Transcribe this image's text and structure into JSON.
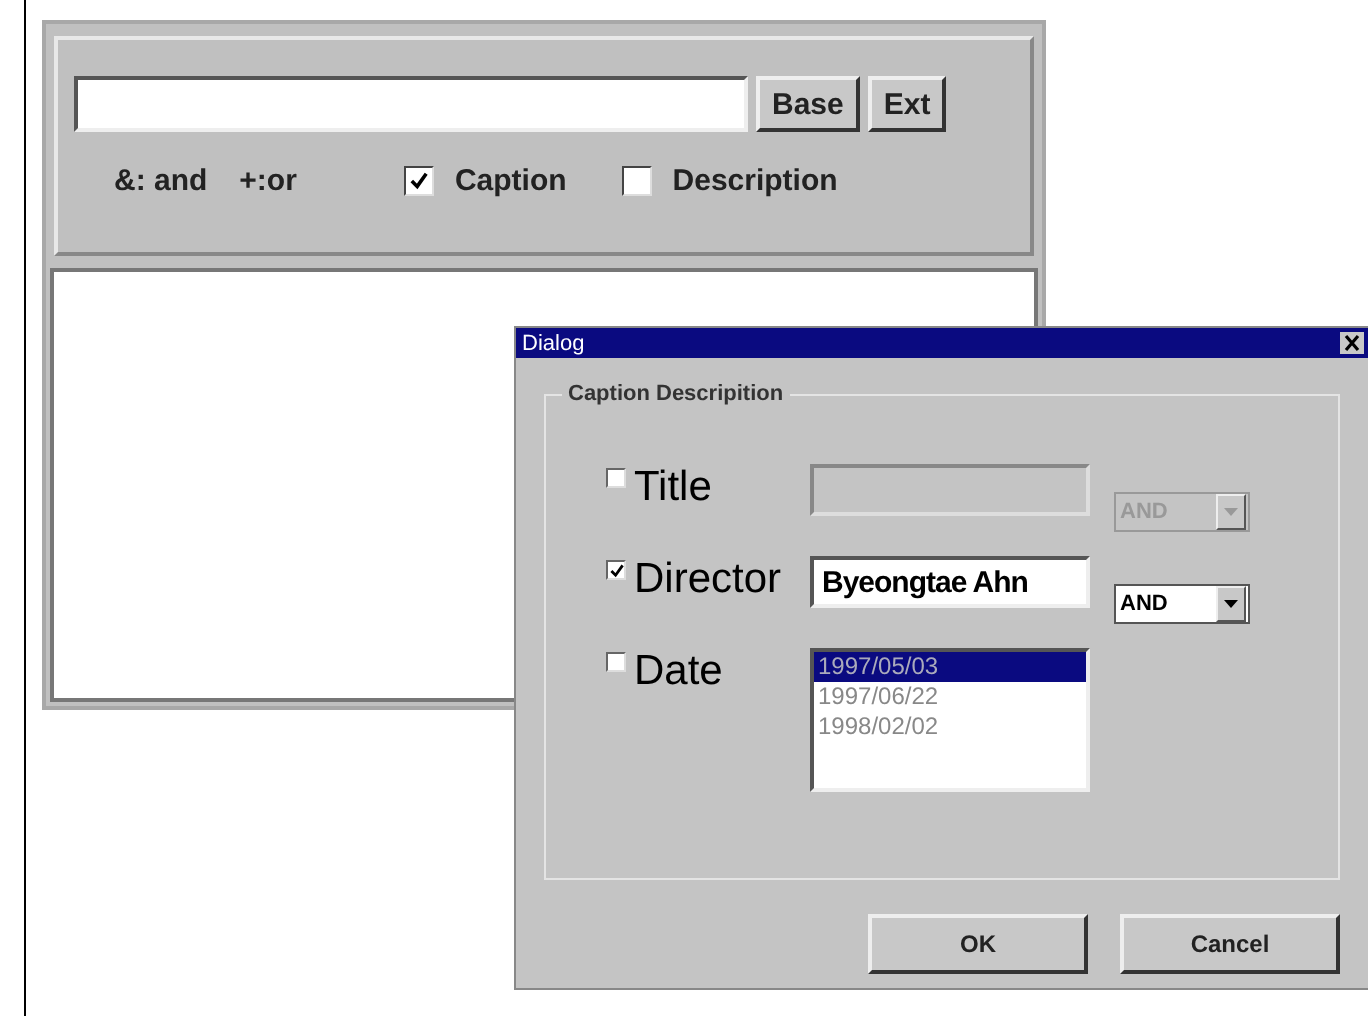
{
  "search": {
    "buttons": [
      "Base",
      "Ext"
    ],
    "hints": [
      "&: and",
      "+:or"
    ],
    "options": [
      {
        "label": "Caption",
        "checked": true
      },
      {
        "label": "Description",
        "checked": false
      }
    ]
  },
  "dialog": {
    "title": "Dialog",
    "group_title": "Caption Descripition",
    "rows": [
      {
        "kind": "text",
        "label": "Title",
        "checked": false,
        "disabled": true,
        "operator": "AND"
      },
      {
        "kind": "text",
        "label": "Director",
        "checked": true,
        "disabled": false,
        "value": "Byeongtae Ahn",
        "operator": "AND"
      },
      {
        "kind": "list",
        "label": "Date",
        "checked": false,
        "items": [
          {
            "text": "1997/05/03",
            "selected": true
          },
          {
            "text": "1997/06/22",
            "selected": false
          },
          {
            "text": "1998/02/02",
            "selected": false
          }
        ]
      }
    ],
    "buttons": [
      "OK",
      "Cancel"
    ]
  }
}
